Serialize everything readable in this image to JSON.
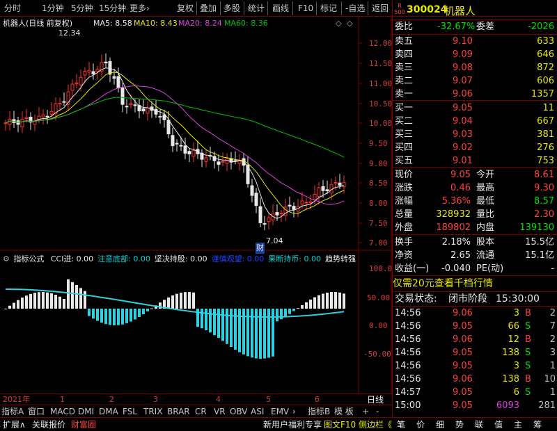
{
  "toolbar": {
    "left": [
      "分时",
      "1分钟",
      "5分钟",
      "15分钟",
      "更多›"
    ],
    "right": [
      "复权",
      "叠加",
      "多股",
      "统计",
      "画线",
      "F10",
      "标记",
      "-自选",
      "返回"
    ]
  },
  "kline": {
    "title": "机器人(日线 前复权)",
    "ma_labels": [
      "MA5: 8.58",
      "MA10: 8.43",
      "MA20: 8.24",
      "MA60: 8.36"
    ],
    "ma_colors": [
      "#e8e8e8",
      "#e8e800",
      "#e040e0",
      "#00c000"
    ],
    "high_label": "12.34",
    "low_label": "7.04",
    "cai_label": "财",
    "price_ticks": [
      "12.00",
      "11.50",
      "11.00",
      "10.50",
      "10.00",
      "9.50",
      "9.00",
      "8.50",
      "8.00",
      "7.50",
      "7.00"
    ]
  },
  "indicator": {
    "title": "指标公式",
    "items": [
      {
        "text": "CCI进: 0.00",
        "color": "#e8e8e8"
      },
      {
        "text": "注意底部: 0.00",
        "color": "#00d0d0"
      },
      {
        "text": "坚决持股: 0.00",
        "color": "#e8e8e8"
      },
      {
        "text": "谨慎观望: 0.00",
        "color": "#2040ff"
      },
      {
        "text": "果断持币: 0.00",
        "color": "#00d0d0"
      },
      {
        "text": "趋势转强",
        "color": "#e8e8e8"
      }
    ],
    "ticks": [
      "100.0",
      "50.00",
      "0.00",
      "-50.00"
    ]
  },
  "dates": [
    "2021年",
    "1",
    "2",
    "3",
    "4",
    "5",
    "6"
  ],
  "dateline_label": "日线",
  "tabs": [
    "指标A",
    "窗口",
    "MACD",
    "DMI",
    "DMA",
    "FSL",
    "TRIX",
    "BRAR",
    "CR",
    "VR",
    "OBV",
    "ASI",
    "EMV",
    "›",
    "指标B",
    "模 板",
    "+",
    "-"
  ],
  "bottom": {
    "left": [
      "扩展∧",
      "关联报价",
      "财富圈"
    ],
    "right": [
      "新用户福利专享",
      "图文F10",
      "侧边栏《"
    ],
    "icons": [
      "笔",
      "价",
      "细",
      "势",
      "联",
      "值",
      "主",
      "筹"
    ]
  },
  "panel": {
    "badge_top": "R",
    "badge_bottom": "500",
    "code": "300024",
    "name": "机器人",
    "weibi_label": "委比",
    "weibi": "-32.67%",
    "weicha_label": "委差",
    "weicha": "-2026",
    "asks": [
      {
        "label": "卖五",
        "price": "9.10",
        "vol": "633"
      },
      {
        "label": "卖四",
        "price": "9.09",
        "vol": "646"
      },
      {
        "label": "卖三",
        "price": "9.08",
        "vol": "872"
      },
      {
        "label": "卖二",
        "price": "9.07",
        "vol": "606"
      },
      {
        "label": "卖一",
        "price": "9.06",
        "vol": "1357"
      }
    ],
    "bids": [
      {
        "label": "买一",
        "price": "9.05",
        "vol": "11"
      },
      {
        "label": "买二",
        "price": "9.04",
        "vol": "667"
      },
      {
        "label": "买三",
        "price": "9.03",
        "vol": "381"
      },
      {
        "label": "买四",
        "price": "9.02",
        "vol": "276"
      },
      {
        "label": "买五",
        "price": "9.01",
        "vol": "753"
      }
    ],
    "stats": [
      {
        "l1": "现价",
        "v1": "9.05",
        "c1": "red",
        "l2": "今开",
        "v2": "8.61",
        "c2": "red"
      },
      {
        "l1": "涨跌",
        "v1": "0.46",
        "c1": "red",
        "l2": "最高",
        "v2": "9.30",
        "c2": "red"
      },
      {
        "l1": "涨幅",
        "v1": "5.36%",
        "c1": "red",
        "l2": "最低",
        "v2": "8.57",
        "c2": "green"
      },
      {
        "l1": "总量",
        "v1": "328932",
        "c1": "yellow",
        "l2": "量比",
        "v2": "2.30",
        "c2": "red"
      },
      {
        "l1": "外盘",
        "v1": "189802",
        "c1": "red",
        "l2": "内盘",
        "v2": "139130",
        "c2": "green"
      }
    ],
    "stats2": [
      {
        "l1": "换手",
        "v1": "2.18%",
        "l2": "股本",
        "v2": "15.5亿"
      },
      {
        "l1": "净资",
        "v1": "2.65",
        "l2": "流通",
        "v2": "15.1亿"
      },
      {
        "l1": "收益(一)",
        "v1": "-0.040",
        "l2": "PE(动)",
        "v2": "-"
      }
    ],
    "promo": "仅需20元查看千档行情",
    "trade_status_label": "交易状态:",
    "trade_status": "闭市阶段",
    "trade_time": "15:30:00",
    "trades": [
      {
        "time": "14:56",
        "price": "9.06",
        "vol": "3",
        "bs": "B",
        "n": "2"
      },
      {
        "time": "14:56",
        "price": "9.05",
        "vol": "66",
        "bs": "S",
        "n": "7"
      },
      {
        "time": "14:56",
        "price": "9.06",
        "vol": "12",
        "bs": "B",
        "n": "2"
      },
      {
        "time": "14:56",
        "price": "9.05",
        "vol": "138",
        "bs": "S",
        "n": "3"
      },
      {
        "time": "14:56",
        "price": "9.05",
        "vol": "3",
        "bs": "S",
        "n": "1"
      },
      {
        "time": "14:56",
        "price": "9.06",
        "vol": "138",
        "bs": "B",
        "n": "10"
      },
      {
        "time": "14:57",
        "price": "9.05",
        "vol": "6",
        "bs": "S",
        "n": "1"
      },
      {
        "time": "15:00",
        "price": "9.05",
        "vol": "6093",
        "bs": "",
        "n": "281"
      }
    ]
  }
}
